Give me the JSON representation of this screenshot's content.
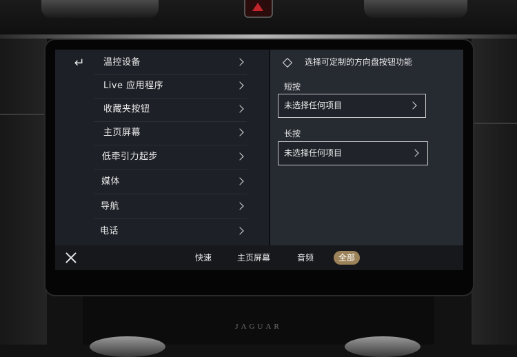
{
  "screen": {
    "menu": {
      "back_icon": "back-arrow-icon",
      "items": [
        {
          "label": "温控设备"
        },
        {
          "label": "Live 应用程序"
        },
        {
          "label": "收藏夹按钮"
        },
        {
          "label": "主页屏幕"
        },
        {
          "label": "低牵引力起步"
        },
        {
          "label": "媒体"
        },
        {
          "label": "导航"
        },
        {
          "label": "电话"
        }
      ]
    },
    "detail": {
      "icon": "diamond-icon",
      "title": "选择可定制的方向盘按钮功能",
      "short_press": {
        "label": "短按",
        "value": "未选择任何项目"
      },
      "long_press": {
        "label": "长按",
        "value": "未选择任何项目"
      }
    },
    "bottom_bar": {
      "close_icon": "close-icon",
      "tabs": [
        {
          "label": "快速",
          "active": false
        },
        {
          "label": "主页屏幕",
          "active": false
        },
        {
          "label": "音频",
          "active": false
        },
        {
          "label": "全部",
          "active": true
        }
      ]
    },
    "colors": {
      "accent": "#9c8259",
      "panel_left": "#1d2026",
      "panel_right": "#262a31"
    }
  },
  "brand": "JAGUAR"
}
